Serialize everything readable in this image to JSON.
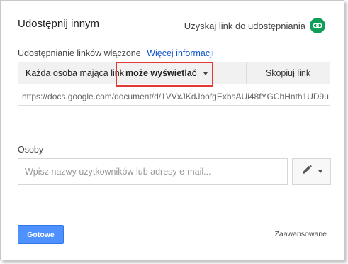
{
  "dialog": {
    "title": "Udostępnij innym",
    "get_link_label": "Uzyskaj link do udostępniania",
    "get_link_icon": "link-icon",
    "accent_color": "#0f9d58"
  },
  "link_sharing": {
    "status_text": "Udostępnianie linków włączone",
    "more_info_link": "Więcej informacji",
    "who_text": "Każda osoba mająca link",
    "permission_value": "może wyświetlać",
    "copy_button": "Skopiuj link",
    "url": "https://docs.google.com/document/d/1VVxJKdJoofgExbsAUi48fYGChHnth1UD9u",
    "highlight_color": "#e53935"
  },
  "people": {
    "label": "Osoby",
    "input_placeholder": "Wpisz nazwy użytkowników lub adresy e-mail...",
    "permission_menu_icon": "pencil-icon"
  },
  "footer": {
    "done_button": "Gotowe",
    "done_color": "#4d90fe",
    "advanced_link": "Zaawansowane"
  }
}
